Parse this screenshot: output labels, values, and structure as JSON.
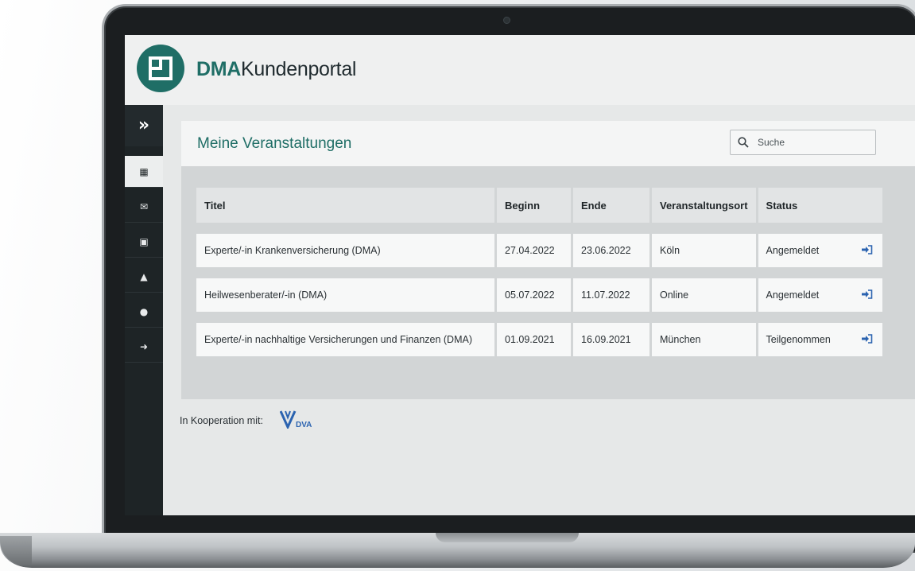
{
  "header": {
    "brand_bold": "DMA",
    "brand_rest": "Kundenportal"
  },
  "sidebar": {
    "expand_label": "»",
    "items": [
      {
        "name": "calendar-icon",
        "glyph": "▦",
        "active": true
      },
      {
        "name": "mail-icon",
        "glyph": "✉",
        "active": false
      },
      {
        "name": "id-card-icon",
        "glyph": "▣",
        "active": false
      },
      {
        "name": "graduation-cap-icon",
        "glyph": "▲",
        "active": false
      },
      {
        "name": "settings-icon",
        "glyph": "●",
        "active": false
      },
      {
        "name": "logout-icon",
        "glyph": "➜",
        "active": false
      }
    ]
  },
  "main": {
    "title": "Meine Veranstaltungen",
    "search": {
      "placeholder": "Suche"
    },
    "table": {
      "headers": [
        "Titel",
        "Beginn",
        "Ende",
        "Veranstaltungsort",
        "Status"
      ],
      "rows": [
        [
          "Experte/-in Krankenversicherung (DMA)",
          "27.04.2022",
          "23.06.2022",
          "Köln",
          "Angemeldet"
        ],
        [
          "Heilwesenberater/-in (DMA)",
          "05.07.2022",
          "11.07.2022",
          "Online",
          "Angemeldet"
        ],
        [
          "Experte/-in nachhaltige Versicherungen und Finanzen (DMA)",
          "01.09.2021",
          "16.09.2021",
          "München",
          "Teilgenommen"
        ]
      ]
    }
  },
  "footer": {
    "cooperation_label": "In Kooperation mit:",
    "partner_logo_text": "DVA"
  },
  "colors": {
    "brand": "#1f6e66",
    "sidebar": "#1e2426",
    "partner": "#2b63b0"
  }
}
